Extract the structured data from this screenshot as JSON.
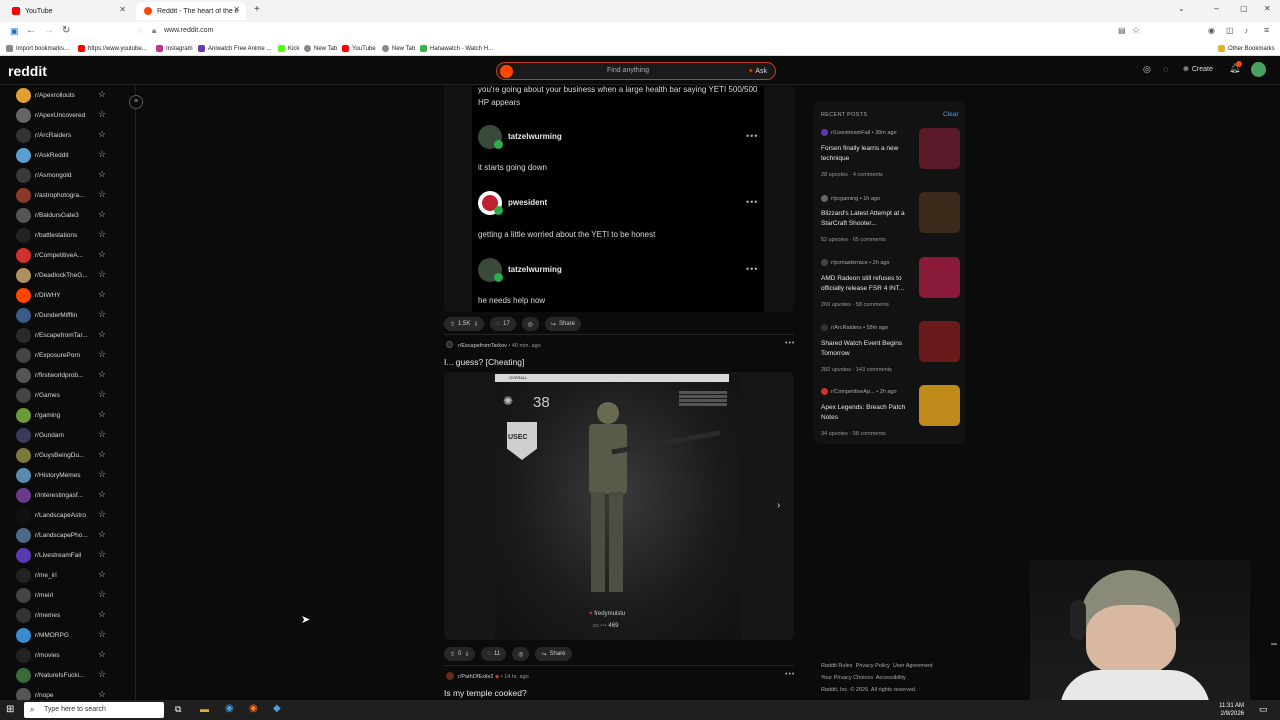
{
  "browser": {
    "tabs": [
      {
        "title": "YouTube",
        "active": false
      },
      {
        "title": "Reddit - The heart of the intern",
        "active": true
      }
    ],
    "new_tab_symbol": "+",
    "url": "www.reddit.com",
    "bookmarks": [
      "Import bookmarks...",
      "https://www.youtube...",
      "Instagram",
      "Aniwatch Free Anime ...",
      "Kick",
      "New Tab",
      "YouTube",
      "New Tab",
      "Hanawatch - Watch H..."
    ],
    "other_bookmarks": "Other Bookmarks"
  },
  "reddit_header": {
    "logo": "reddit",
    "search_placeholder": "Find anything",
    "ask_label": "Ask",
    "create_label": "Create",
    "colors": {
      "accent": "#ff4500"
    }
  },
  "sidebar": {
    "subreddits": [
      {
        "name": "r/Apexrollouts",
        "color": "#e0a030"
      },
      {
        "name": "r/ApexUncovered",
        "color": "#666"
      },
      {
        "name": "r/ArcRaiders",
        "color": "#333"
      },
      {
        "name": "r/AskReddit",
        "color": "#5aa0d0"
      },
      {
        "name": "r/Asmongold",
        "color": "#3a3a3a"
      },
      {
        "name": "r/astrophotogra...",
        "color": "#8a3a2a"
      },
      {
        "name": "r/BaldursGate3",
        "color": "#555"
      },
      {
        "name": "r/battlestations",
        "color": "#222"
      },
      {
        "name": "r/CompetitiveA...",
        "color": "#d03030"
      },
      {
        "name": "r/DeadlockTheG...",
        "color": "#b09060"
      },
      {
        "name": "r/DIWHY",
        "color": "#ff4500"
      },
      {
        "name": "r/DunderMifflin",
        "color": "#3a5a8a"
      },
      {
        "name": "r/EscapefromTar...",
        "color": "#2a2a2a"
      },
      {
        "name": "r/ExposurePorn",
        "color": "#444"
      },
      {
        "name": "r/firstworldprob...",
        "color": "#555"
      },
      {
        "name": "r/Games",
        "color": "#444"
      },
      {
        "name": "r/gaming",
        "color": "#6a9a3a"
      },
      {
        "name": "r/Gundam",
        "color": "#3a3a5a"
      },
      {
        "name": "r/GuysBeingDu...",
        "color": "#7a7a3a"
      },
      {
        "name": "r/HistoryMemes",
        "color": "#5a8ab0"
      },
      {
        "name": "r/interestingasf...",
        "color": "#6a3a8a"
      },
      {
        "name": "r/LandscapeAstro",
        "color": "#111"
      },
      {
        "name": "r/LandscapePho...",
        "color": "#4a6a8a"
      },
      {
        "name": "r/LivestreamFail",
        "color": "#5a3ab0"
      },
      {
        "name": "r/me_irl",
        "color": "#222"
      },
      {
        "name": "r/meirl",
        "color": "#444"
      },
      {
        "name": "r/memes",
        "color": "#333"
      },
      {
        "name": "r/MMORPG",
        "color": "#3a8ad0"
      },
      {
        "name": "r/movies",
        "color": "#222"
      },
      {
        "name": "r/NatureIsFucki...",
        "color": "#3a6a3a"
      },
      {
        "name": "r/nope",
        "color": "#555"
      }
    ]
  },
  "feed": {
    "first_post_body": "you're going about your business when a large health bar saying YETI 500/500 HP appears",
    "comments": [
      {
        "user": "tatzelwurming",
        "text": "it starts going down"
      },
      {
        "user": "pwesident",
        "text": "getting a little worried about the YETI to be honest"
      },
      {
        "user": "tatzelwurming",
        "text": "he needs help now"
      }
    ],
    "post1_actions": {
      "votes": "1.5K",
      "comments": "17",
      "share": "Share"
    },
    "post2": {
      "subreddit": "r/EscapefromTarkov",
      "time": "40 min. ago",
      "title": "I... guess? [Cheating]",
      "image_label": "OVERALL",
      "level": "38",
      "faction": "USEC",
      "player": "fredymuistu",
      "player_stat": "469",
      "votes": "0",
      "comments": "11",
      "share": "Share"
    },
    "post3": {
      "subreddit": "r/PathOfExile2",
      "time": "14 hr. ago",
      "title": "Is my temple cooked?"
    }
  },
  "recent_posts": {
    "heading": "RECENT POSTS",
    "clear_label": "Clear",
    "items": [
      {
        "sub": "r/LivestreamFail",
        "time": "38m ago",
        "title": "Forsen finally learns a new technique",
        "upvotes": "28 upvotes",
        "comments": "4 comments",
        "thumb_color": "#5a1a2a",
        "sub_color": "#5a3ab0"
      },
      {
        "sub": "r/pcgaming",
        "time": "1h ago",
        "title": "Blizzard's Latest Attempt at a StarCraft Shooter...",
        "upvotes": "52 upvotes",
        "comments": "65 comments",
        "thumb_color": "#3a2a1a",
        "sub_color": "#666"
      },
      {
        "sub": "r/pcmasterrace",
        "time": "2h ago",
        "title": "AMD Radeon still refuses to officially release FSR 4 INT...",
        "upvotes": "269 upvotes",
        "comments": "58 comments",
        "thumb_color": "#8a1a3a",
        "sub_color": "#444"
      },
      {
        "sub": "r/ArcRaiders",
        "time": "58m ago",
        "title": "Shared Watch Event Begins Tomorrow",
        "upvotes": "282 upvotes",
        "comments": "143 comments",
        "thumb_color": "#6a1a1a",
        "sub_color": "#333"
      },
      {
        "sub": "r/CompetitiveAp...",
        "time": "2h ago",
        "title": "Apex Legends: Breach Patch Notes",
        "upvotes": "34 upvotes",
        "comments": "58 comments",
        "thumb_color": "#c08a1a",
        "sub_color": "#d03030"
      }
    ]
  },
  "footer": {
    "links_row1": [
      "Reddit Rules",
      "Privacy Policy",
      "User Agreement"
    ],
    "links_row2": [
      "Your Privacy Choices",
      "Accessibility"
    ],
    "copyright": "Reddit, Inc. © 2026. All rights reserved."
  },
  "taskbar": {
    "search_placeholder": "Type here to search",
    "time": "11:31 AM",
    "date": "2/9/2026"
  }
}
